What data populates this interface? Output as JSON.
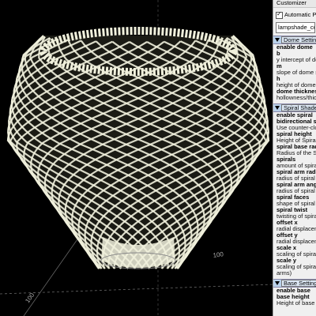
{
  "customizer": {
    "title": "Customizer",
    "automatic_preview_label": "Automatic Preview",
    "automatic_preview_checked": true,
    "preset_value": "lampshade_conve",
    "groups": [
      {
        "label": "Dome Settings",
        "rows": [
          {
            "text": "enable dome",
            "style": "bold"
          },
          {
            "text": "b",
            "style": "bold"
          },
          {
            "text": "y intercept of dom",
            "style": "desc"
          },
          {
            "text": "m",
            "style": "bold"
          },
          {
            "text": "slope of dome sha",
            "style": "desc"
          },
          {
            "text": "h",
            "style": "bold"
          },
          {
            "text": "height of dome",
            "style": "desc"
          },
          {
            "text": "dome thicknes",
            "style": "bold"
          },
          {
            "text": "hollowness/thickn",
            "style": "desc"
          }
        ]
      },
      {
        "label": "Spiral Shade S",
        "rows": [
          {
            "text": "enable spiral",
            "style": "bold"
          },
          {
            "text": "bidirectional spira",
            "style": "bold"
          },
          {
            "text": "Use counter-clock",
            "style": "desc"
          },
          {
            "text": "spiral height",
            "style": "bold"
          },
          {
            "text": "Height of Spiral sh",
            "style": "desc"
          },
          {
            "text": "spiral base rad",
            "style": "bold"
          },
          {
            "text": "Radius of the Spir",
            "style": "desc"
          },
          {
            "text": "spirals",
            "style": "bold"
          },
          {
            "text": "amount of spirals",
            "style": "desc"
          },
          {
            "text": "spiral arm radi",
            "style": "bold"
          },
          {
            "text": "radius of spiral ar",
            "style": "desc"
          },
          {
            "text": "spiral arm angl",
            "style": "bold"
          },
          {
            "text": "radius of spiral ar",
            "style": "desc"
          },
          {
            "text": "spiral faces",
            "style": "bold"
          },
          {
            "text": "shape of spiral ar",
            "style": "desc"
          },
          {
            "text": "spiral twist",
            "style": "bold"
          },
          {
            "text": "twisting of spiral a",
            "style": "desc"
          },
          {
            "text": "offset x",
            "style": "bold"
          },
          {
            "text": "radial displaceme",
            "style": "desc"
          },
          {
            "text": "offset y",
            "style": "bold"
          },
          {
            "text": "radial displaceme",
            "style": "desc"
          },
          {
            "text": "scale x",
            "style": "bold"
          },
          {
            "text": "scaling of spiral ty",
            "style": "desc"
          },
          {
            "text": "scale y",
            "style": "bold"
          },
          {
            "text": "scaling of spiral ty",
            "style": "desc"
          },
          {
            "text": "arms)",
            "style": "desc"
          }
        ]
      },
      {
        "label": "Base Settings",
        "rows": [
          {
            "text": "enable base",
            "style": "bold"
          },
          {
            "text": "base height",
            "style": "bold"
          },
          {
            "text": "Height of base",
            "style": "desc"
          }
        ]
      }
    ]
  },
  "viewport": {
    "axis_tick_labels": [
      "100",
      "100"
    ],
    "model_color": "#f0f0dc",
    "background": "#000000"
  }
}
